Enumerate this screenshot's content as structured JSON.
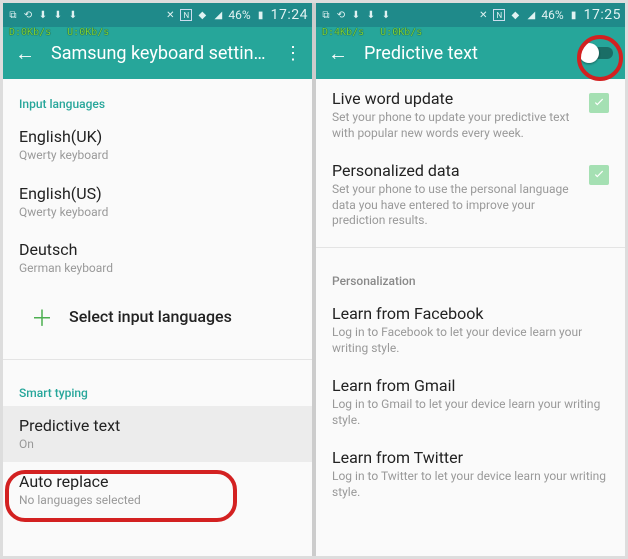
{
  "left": {
    "statusbar": {
      "time": "17:24",
      "battery": "46%",
      "speed_down": "D:0Kb/s",
      "speed_up": "U:0Kb/s"
    },
    "appbar": {
      "title": "Samsung keyboard settings"
    },
    "sections": {
      "input_languages_header": "Input languages",
      "langs": [
        {
          "name": "English(UK)",
          "sub": "Qwerty keyboard"
        },
        {
          "name": "English(US)",
          "sub": "Qwerty keyboard"
        },
        {
          "name": "Deutsch",
          "sub": "German keyboard"
        }
      ],
      "select_input_languages": "Select input languages",
      "smart_typing_header": "Smart typing",
      "predictive": {
        "title": "Predictive text",
        "sub": "On"
      },
      "auto_replace": {
        "title": "Auto replace",
        "sub": "No languages selected"
      }
    }
  },
  "right": {
    "statusbar": {
      "time": "17:25",
      "battery": "46%",
      "speed_down": "D:4Kb/s",
      "speed_up": "U:0Kb/s"
    },
    "appbar": {
      "title": "Predictive text"
    },
    "items": {
      "live_word_update": {
        "title": "Live word update",
        "desc": "Set your phone to update your predictive text with popular new words every week.",
        "checked": true
      },
      "personalized_data": {
        "title": "Personalized data",
        "desc": "Set your phone to use the personal language data you have entered to improve your prediction results.",
        "checked": true
      },
      "personalization_header": "Personalization",
      "learn_facebook": {
        "title": "Learn from Facebook",
        "desc": "Log in to Facebook to let your device learn your writing style."
      },
      "learn_gmail": {
        "title": "Learn from Gmail",
        "desc": "Log in to Gmail to let your device learn your writing style."
      },
      "learn_twitter": {
        "title": "Learn from Twitter",
        "desc": "Log in to Twitter to let your device learn your writing style."
      }
    }
  }
}
